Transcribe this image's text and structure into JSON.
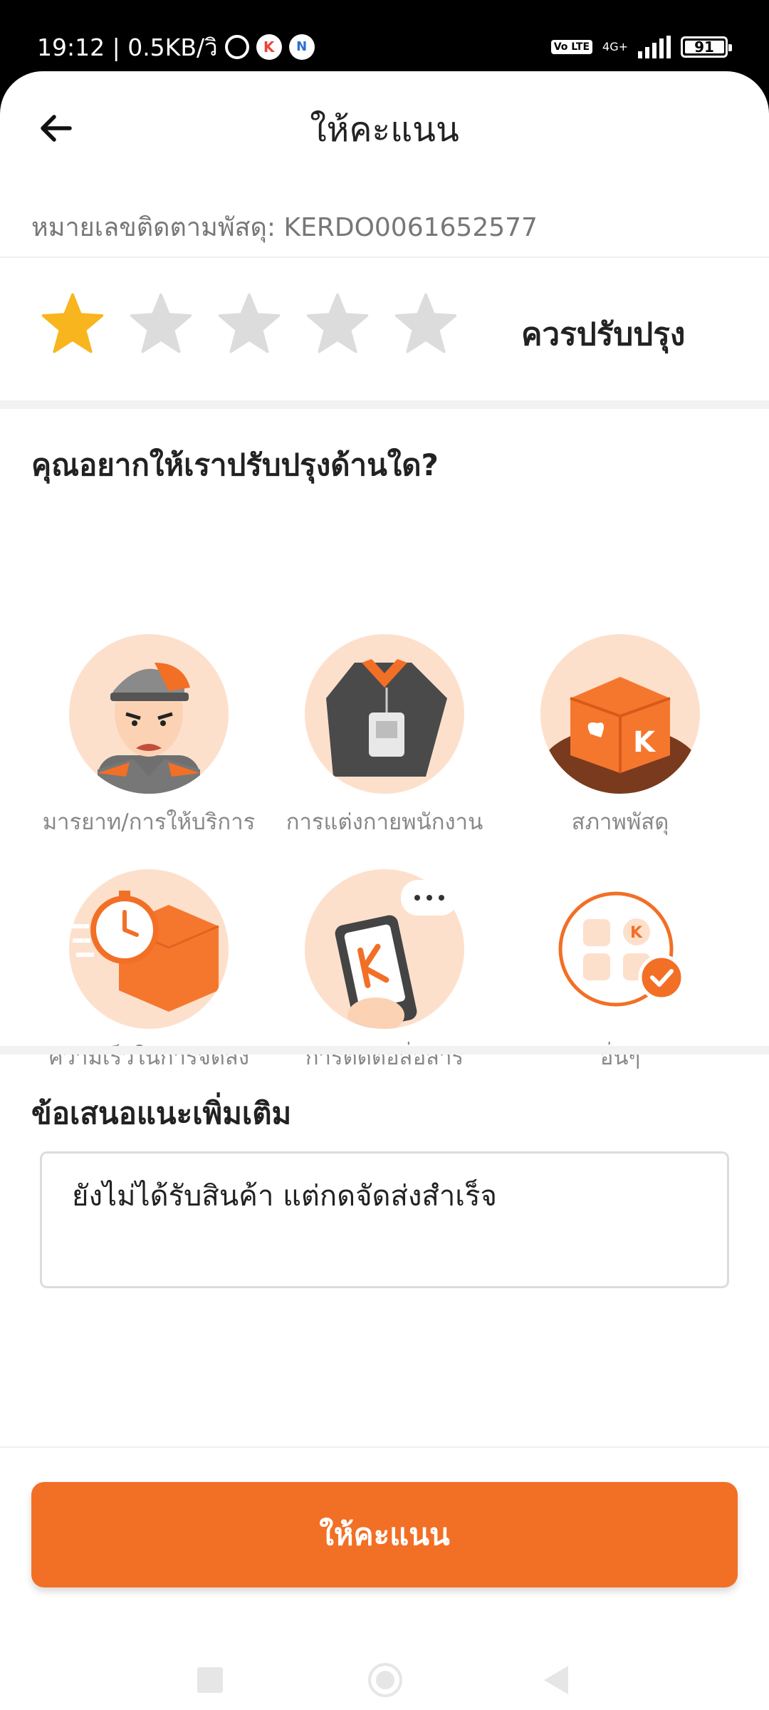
{
  "status_bar": {
    "time_speed": "19:12 | 0.5KB/วิ",
    "volte": "Vo LTE",
    "network": "4G+",
    "battery_level": "91"
  },
  "header": {
    "title": "ให้คะแนน",
    "back_icon": "arrow-left-icon"
  },
  "tracking": {
    "text": "หมายเลขติดตามพัสดุ: KERDO0061652577"
  },
  "rating": {
    "selected_stars": 1,
    "max_stars": 5,
    "label": "ควรปรับปรุง",
    "active_color": "#f8b51e",
    "inactive_color": "#dcdcdc"
  },
  "improve": {
    "title": "คุณอยากให้เราปรับปรุงด้านใด?",
    "categories": [
      {
        "label": "มารยาท/การให้บริการ",
        "icon": "courier-avatar-icon"
      },
      {
        "label": "การแต่งกายพนักงาน",
        "icon": "uniform-icon"
      },
      {
        "label": "สภาพพัสดุ",
        "icon": "damaged-box-icon"
      },
      {
        "label": "ความเร็วในการจัดส่ง",
        "icon": "speed-box-icon"
      },
      {
        "label": "การติดต่อสื่อสาร",
        "icon": "phone-chat-icon"
      },
      {
        "label": "อื่นๆ",
        "icon": "others-grid-icon"
      }
    ]
  },
  "suggestion": {
    "title": "ข้อเสนอแนะเพิ่มเติม",
    "value": "ยังไม่ได้รับสินค้า แต่กดจัดส่งสำเร็จ"
  },
  "submit": {
    "label": "ให้คะแนน",
    "color": "#f26f26"
  }
}
